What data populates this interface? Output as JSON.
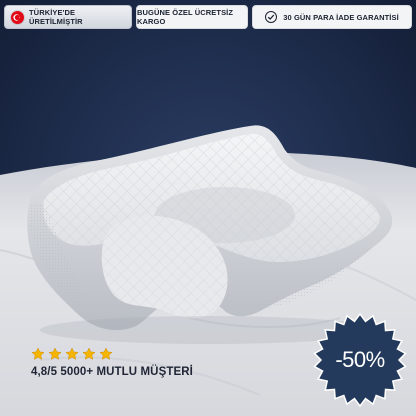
{
  "badges": {
    "made_in": "TÜRKİYE'DE ÜRETİLMİŞTİR",
    "shipping": "BUGÜNE ÖZEL ÜCRETSİZ KARGO",
    "guarantee": "30 GÜN PARA İADE GARANTİSİ"
  },
  "discount": {
    "label": "-50%",
    "color": "#243a5c"
  },
  "rating": {
    "stars": 5,
    "text": "4,8/5 5000+ MUTLU MÜŞTERİ",
    "star_color": "#f5b400"
  },
  "colors": {
    "backdrop": "#1b2844",
    "sheet": "#dfe1e6",
    "pillow": "#eef0f2"
  },
  "icons": [
    "turkey-flag-icon",
    "check-circle-icon",
    "star-icon"
  ]
}
